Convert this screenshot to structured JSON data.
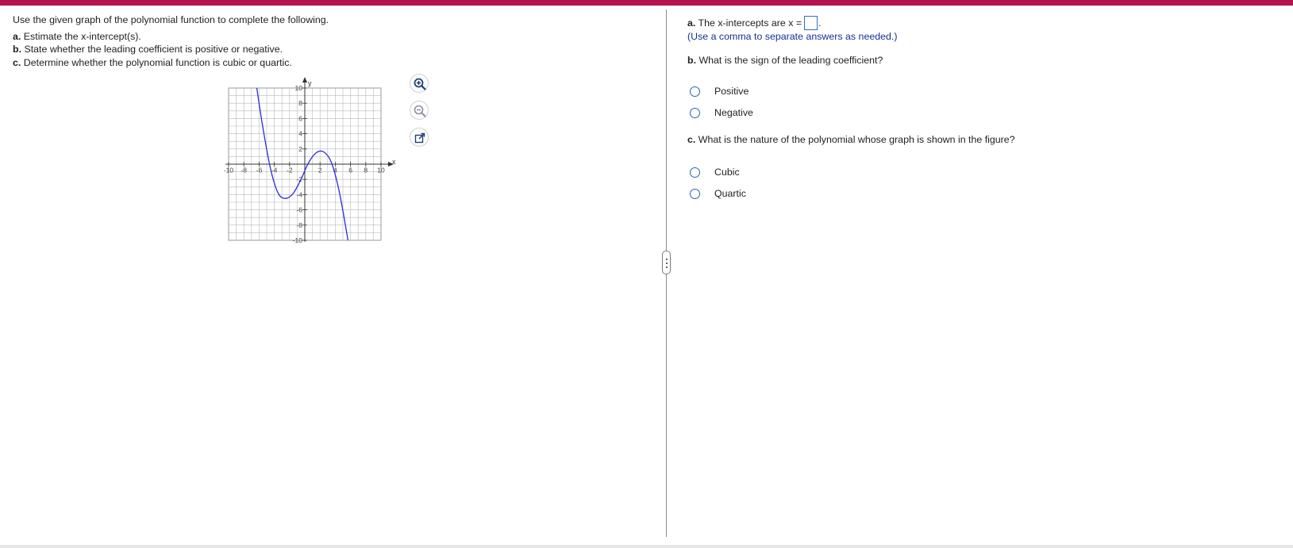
{
  "instructions": {
    "lead": "Use the given graph of the polynomial function to complete the following.",
    "items": [
      {
        "tag": "a.",
        "text": " Estimate the x-intercept(s)."
      },
      {
        "tag": "b.",
        "text": " State whether the leading coefficient is positive or negative."
      },
      {
        "tag": "c.",
        "text": " Determine whether the polynomial function is cubic or quartic."
      }
    ]
  },
  "graph": {
    "x_label": "x",
    "y_label": "y",
    "x_ticks": [
      "-10",
      "-8",
      "-6",
      "-4",
      "-2",
      "2",
      "4",
      "6",
      "8",
      "10"
    ],
    "y_ticks": [
      "10",
      "8",
      "6",
      "4",
      "2",
      "-2",
      "-4",
      "-6",
      "-8",
      "-10"
    ],
    "xlim": [
      -10,
      10
    ],
    "ylim": [
      -10,
      10
    ],
    "curve_color": "#2b2bd6",
    "grid_color": "#b9b9b9",
    "curve_points": [
      [
        -6.3,
        10
      ],
      [
        -5.5,
        4.8
      ],
      [
        -4.5,
        -0.6
      ],
      [
        -3.5,
        -3.8
      ],
      [
        -2.5,
        -4.5
      ],
      [
        -1.5,
        -3.8
      ],
      [
        -0.5,
        -2.0
      ],
      [
        0.5,
        0.2
      ],
      [
        1.5,
        1.5
      ],
      [
        2.5,
        1.6
      ],
      [
        3.5,
        0.2
      ],
      [
        4.5,
        -3.5
      ],
      [
        5.5,
        -9.0
      ],
      [
        5.65,
        -10
      ]
    ]
  },
  "tools": {
    "zoom_in": "magnifier-plus-icon",
    "zoom_out": "magnifier-minus-icon",
    "popout": "external-link-icon"
  },
  "questions": {
    "a": {
      "tag": "a.",
      "text": " The x-intercepts are x =",
      "end": ".",
      "hint": "(Use a comma to separate answers as needed.)"
    },
    "b": {
      "tag": "b.",
      "text": " What is the sign of the leading coefficient?",
      "options": [
        "Positive",
        "Negative"
      ]
    },
    "c": {
      "tag": "c.",
      "text": " What is the nature of the polynomial whose graph is shown in the figure?",
      "options": [
        "Cubic",
        "Quartic"
      ]
    }
  },
  "colors": {
    "accent_bar": "#b5134f",
    "hint_text": "#1a2f96",
    "radio_border": "#2864b8"
  }
}
